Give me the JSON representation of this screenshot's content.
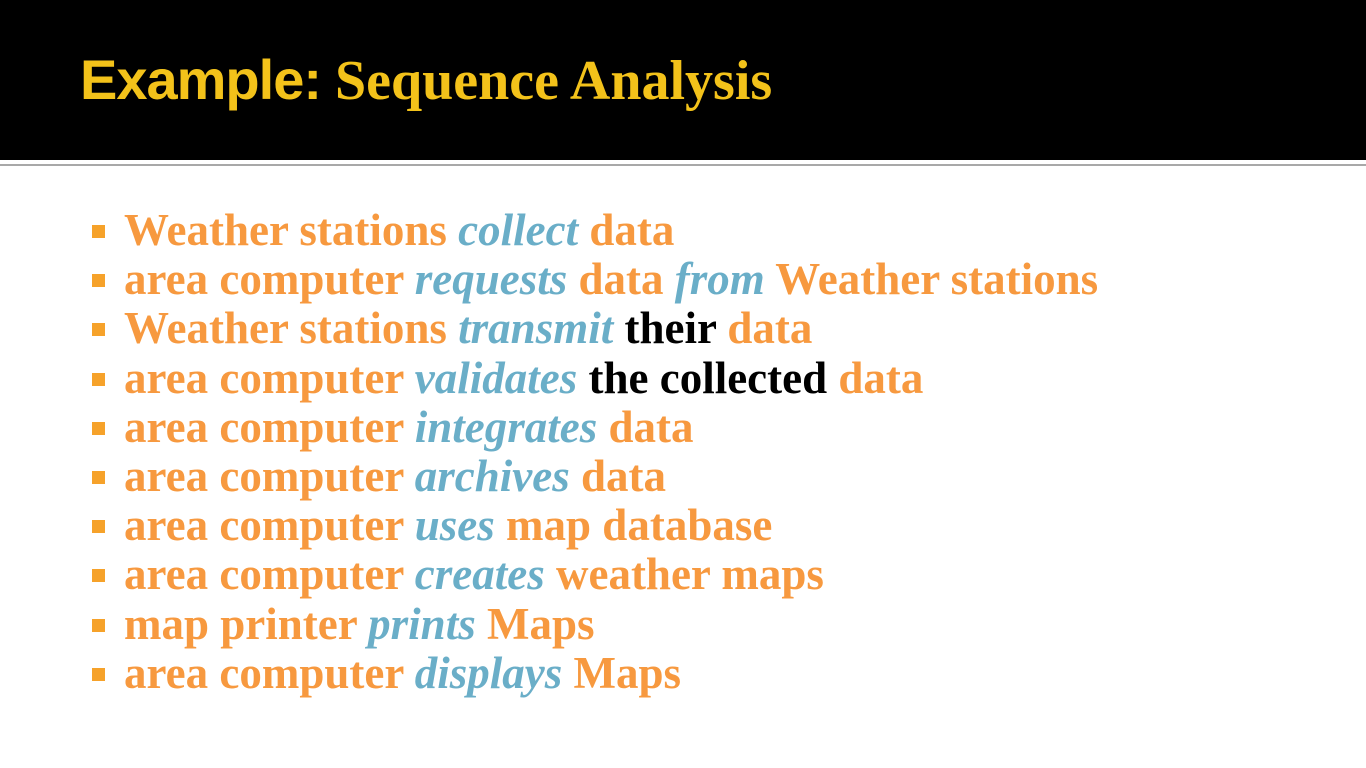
{
  "slide": {
    "title": {
      "part1": "Example:",
      "part2": "Sequence Analysis"
    },
    "bullets": [
      [
        {
          "text": "Weather stations",
          "role": "subject"
        },
        {
          "text": "collect",
          "role": "verb"
        },
        {
          "text": "data",
          "role": "object"
        }
      ],
      [
        {
          "text": "area computer",
          "role": "subject"
        },
        {
          "text": "requests",
          "role": "verb"
        },
        {
          "text": "data",
          "role": "object"
        },
        {
          "text": "from",
          "role": "verb"
        },
        {
          "text": "Weather stations",
          "role": "object"
        }
      ],
      [
        {
          "text": "Weather stations",
          "role": "subject"
        },
        {
          "text": "transmit",
          "role": "verb"
        },
        {
          "text": "their",
          "role": "plain"
        },
        {
          "text": "data",
          "role": "object"
        }
      ],
      [
        {
          "text": "area computer",
          "role": "subject"
        },
        {
          "text": "validates",
          "role": "verb"
        },
        {
          "text": "the collected",
          "role": "plain"
        },
        {
          "text": "data",
          "role": "object"
        }
      ],
      [
        {
          "text": "area computer",
          "role": "subject"
        },
        {
          "text": "integrates",
          "role": "verb"
        },
        {
          "text": "data",
          "role": "object"
        }
      ],
      [
        {
          "text": "area computer",
          "role": "subject"
        },
        {
          "text": "archives",
          "role": "verb"
        },
        {
          "text": "data",
          "role": "object"
        }
      ],
      [
        {
          "text": "area computer",
          "role": "subject"
        },
        {
          "text": "uses",
          "role": "verb"
        },
        {
          "text": "map database",
          "role": "object"
        }
      ],
      [
        {
          "text": "area computer",
          "role": "subject"
        },
        {
          "text": "creates",
          "role": "verb"
        },
        {
          "text": "weather maps",
          "role": "object"
        }
      ],
      [
        {
          "text": "map printer",
          "role": "subject"
        },
        {
          "text": "prints",
          "role": "verb"
        },
        {
          "text": "Maps",
          "role": "object"
        }
      ],
      [
        {
          "text": "area computer",
          "role": "subject"
        },
        {
          "text": "displays",
          "role": "verb"
        },
        {
          "text": "Maps",
          "role": "object"
        }
      ]
    ]
  },
  "colors": {
    "title_bar": "#000000",
    "title_text": "#f3c21a",
    "subject_object": "#f7993f",
    "verb": "#6aaec8",
    "plain": "#000000",
    "bullet_marker": "#f6a22a"
  },
  "icons": {
    "bullet_marker": "square-bullet-icon"
  }
}
